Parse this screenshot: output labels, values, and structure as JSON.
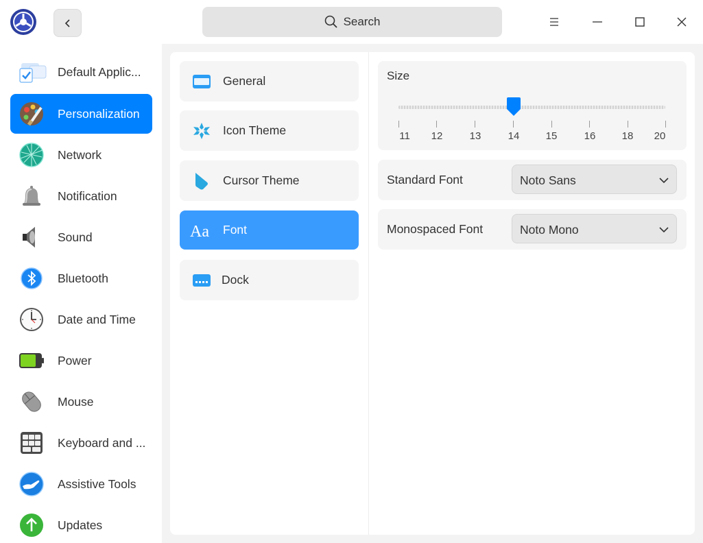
{
  "header": {
    "search_label": "Search"
  },
  "sidebar": {
    "items": [
      {
        "label": "Default Applic...",
        "icon": "default-applications-icon"
      },
      {
        "label": "Personalization",
        "icon": "personalization-icon",
        "active": true
      },
      {
        "label": "Network",
        "icon": "network-icon"
      },
      {
        "label": "Notification",
        "icon": "notification-bell-icon"
      },
      {
        "label": "Sound",
        "icon": "speaker-icon"
      },
      {
        "label": "Bluetooth",
        "icon": "bluetooth-icon"
      },
      {
        "label": "Date and Time",
        "icon": "clock-icon"
      },
      {
        "label": "Power",
        "icon": "battery-icon"
      },
      {
        "label": "Mouse",
        "icon": "mouse-icon"
      },
      {
        "label": "Keyboard and ...",
        "icon": "keyboard-icon"
      },
      {
        "label": "Assistive Tools",
        "icon": "assistive-tools-icon"
      },
      {
        "label": "Updates",
        "icon": "update-arrow-icon"
      }
    ]
  },
  "subnav": {
    "items": [
      {
        "label": "General",
        "icon": "window-icon"
      },
      {
        "label": "Icon Theme",
        "icon": "snowflake-icon"
      },
      {
        "label": "Cursor Theme",
        "icon": "cursor-icon"
      },
      {
        "label": "Font",
        "icon": "font-aa-icon",
        "active": true
      },
      {
        "label": "Dock",
        "icon": "dock-icon"
      }
    ]
  },
  "font_settings": {
    "size_label": "Size",
    "size_value": 14,
    "size_ticks": [
      "11",
      "12",
      "13",
      "14",
      "15",
      "16",
      "18",
      "20"
    ],
    "standard_font_label": "Standard Font",
    "standard_font_value": "Noto Sans",
    "mono_font_label": "Monospaced Font",
    "mono_font_value": "Noto Mono"
  },
  "colors": {
    "accent": "#0081ff",
    "sub_active": "#3a9bff"
  }
}
